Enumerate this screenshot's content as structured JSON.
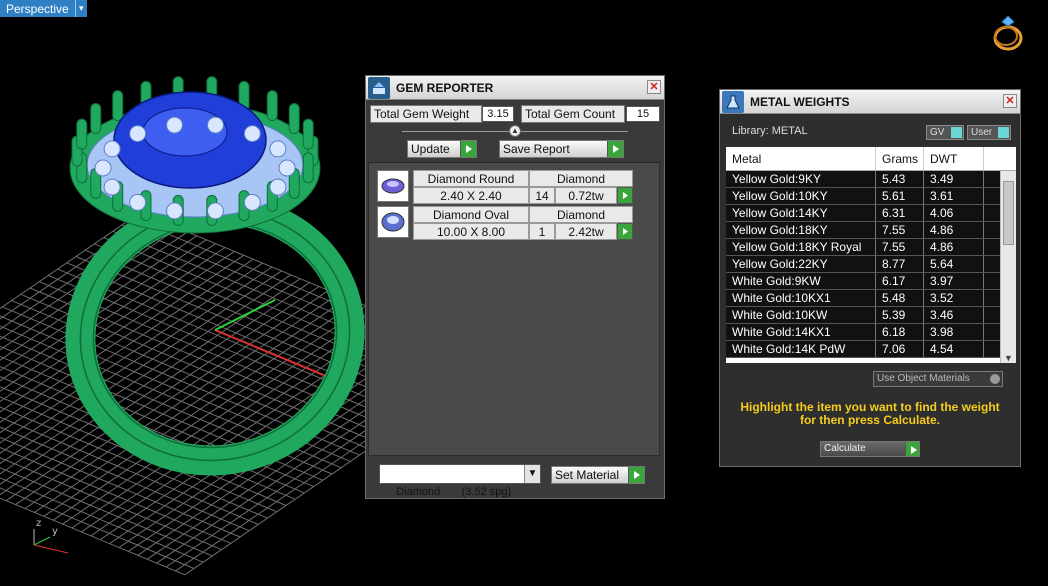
{
  "viewport": {
    "view_label": "Perspective",
    "colors": {
      "grid": "#6e6e6e",
      "ring": "#1fa85e",
      "gem": "#1f3fd8",
      "accent_stones": "#a8c6f5",
      "axis_red": "#e03030",
      "axis_green": "#2ecc40"
    },
    "axis_labels": {
      "z": "z",
      "y": "y"
    }
  },
  "gem_reporter": {
    "title": "GEM REPORTER",
    "total_weight_label": "Total Gem Weight",
    "total_weight_value": "3.15",
    "total_count_label": "Total Gem Count",
    "total_count_value": "15",
    "update_label": "Update",
    "save_label": "Save Report",
    "gems": [
      {
        "name": "Diamond Round",
        "material": "Diamond",
        "size": "2.40 X 2.40",
        "count": "14",
        "weight": "0.72tw"
      },
      {
        "name": "Diamond Oval",
        "material": "Diamond",
        "size": "10.00 X 8.00",
        "count": "1",
        "weight": "2.42tw"
      }
    ],
    "material_select": "Diamond       (3.52 spg)",
    "set_material_label": "Set Material"
  },
  "metal_weights": {
    "title": "METAL WEIGHTS",
    "library_label": "Library: METAL",
    "gv_label": "GV",
    "user_label": "User",
    "columns": [
      "Metal",
      "Grams",
      "DWT"
    ],
    "rows": [
      [
        "Yellow Gold:9KY",
        "5.43",
        "3.49"
      ],
      [
        "Yellow Gold:10KY",
        "5.61",
        "3.61"
      ],
      [
        "Yellow Gold:14KY",
        "6.31",
        "4.06"
      ],
      [
        "Yellow Gold:18KY",
        "7.55",
        "4.86"
      ],
      [
        "Yellow Gold:18KY Royal",
        "7.55",
        "4.86"
      ],
      [
        "Yellow Gold:22KY",
        "8.77",
        "5.64"
      ],
      [
        "White Gold:9KW",
        "6.17",
        "3.97"
      ],
      [
        "White Gold:10KX1",
        "5.48",
        "3.52"
      ],
      [
        "White Gold:10KW",
        "5.39",
        "3.46"
      ],
      [
        "White Gold:14KX1",
        "6.18",
        "3.98"
      ],
      [
        "White Gold:14K PdW",
        "7.06",
        "4.54"
      ]
    ],
    "use_object_materials_label": "Use Object Materials",
    "hint_line1": "Highlight the item you want to find the weight",
    "hint_line2": "for then press Calculate.",
    "calculate_label": "Calculate"
  }
}
